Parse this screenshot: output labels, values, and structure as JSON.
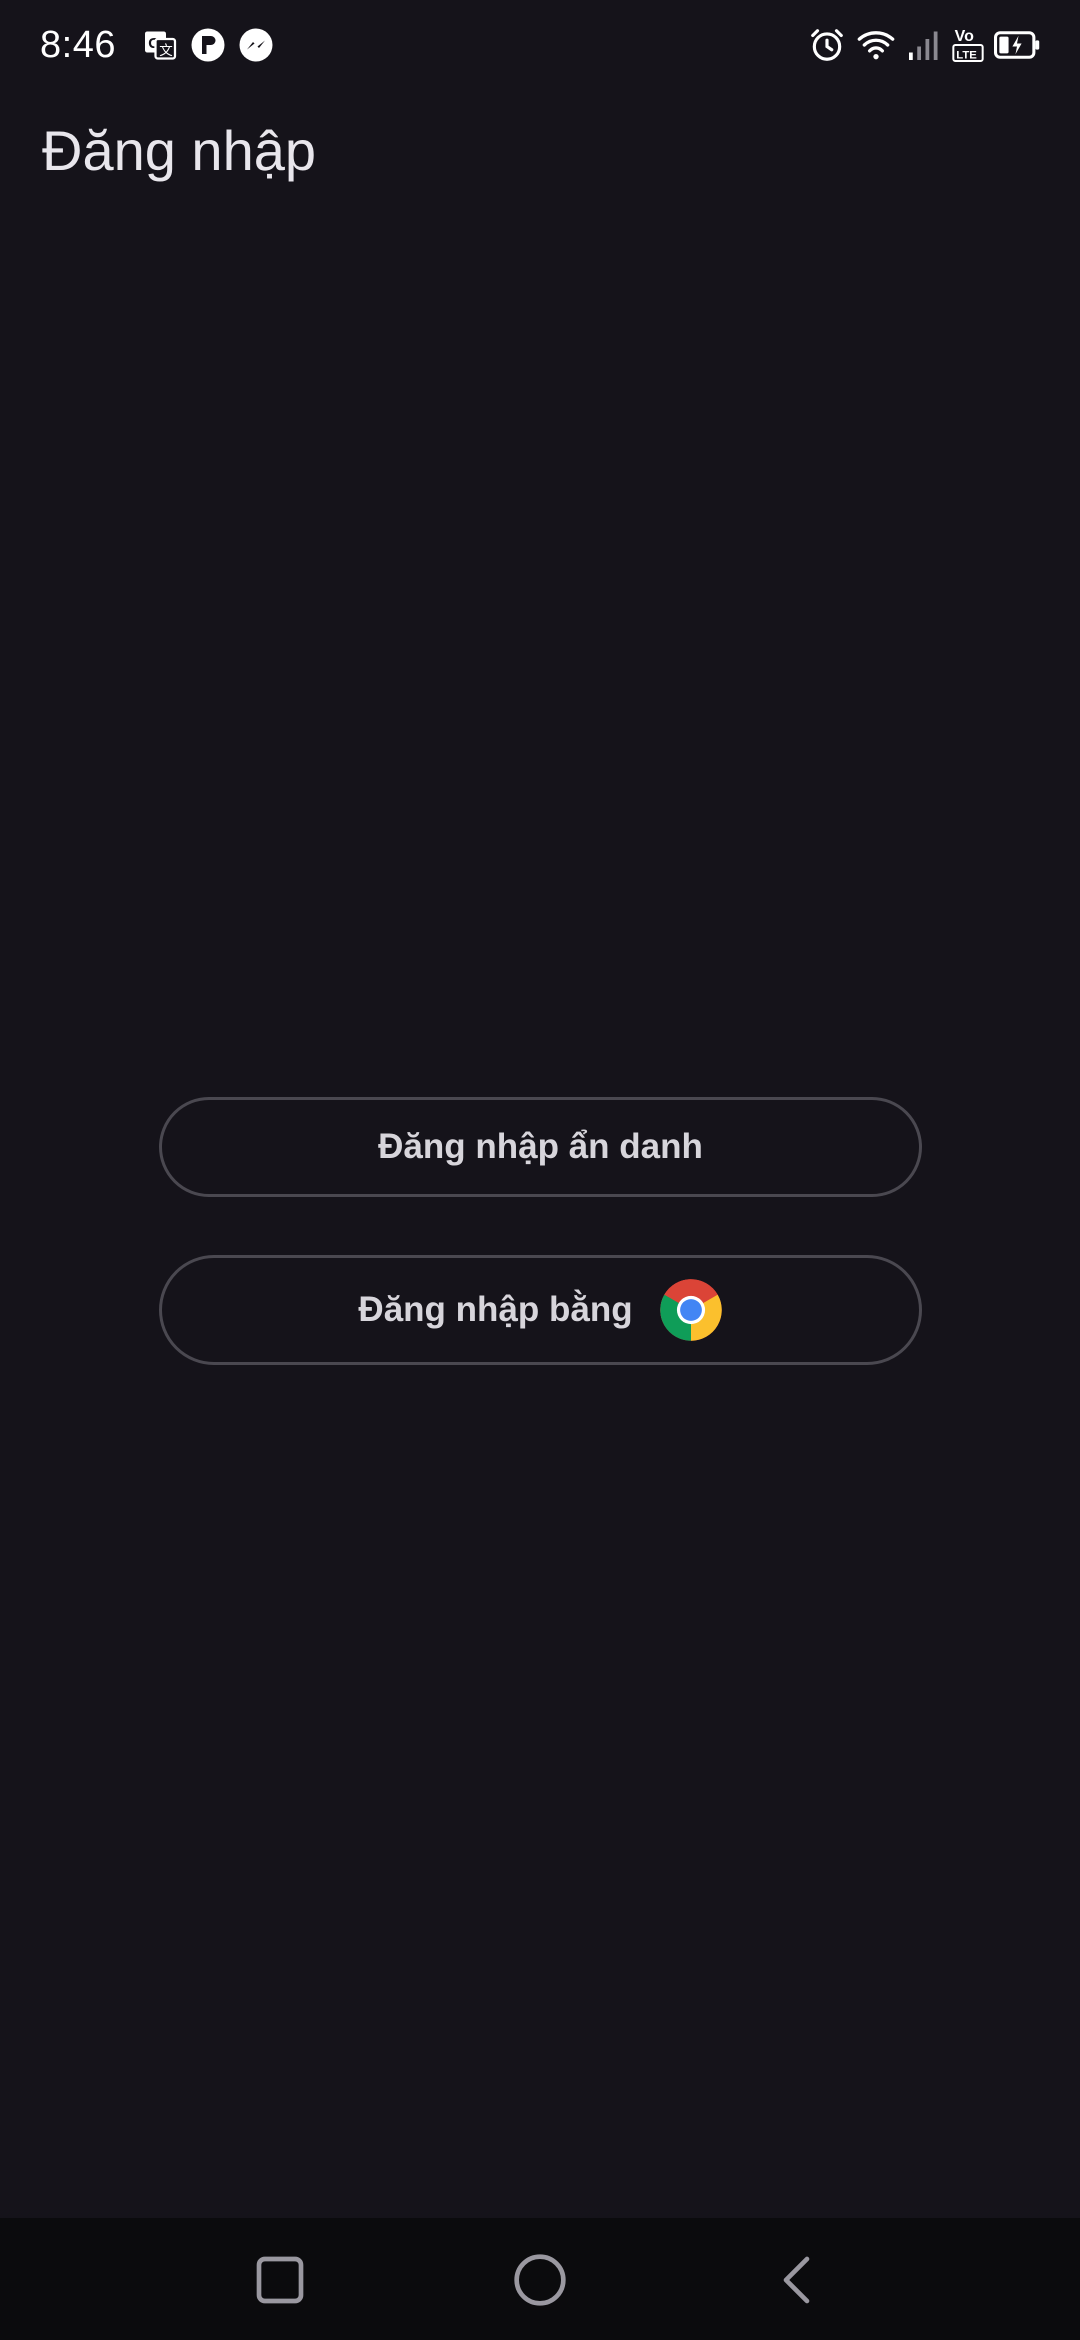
{
  "status_bar": {
    "time": "8:46",
    "notification_icons": [
      "translate-icon",
      "app-notification-icon",
      "messenger-icon"
    ],
    "system_icons": [
      "alarm-icon",
      "wifi-icon",
      "signal-icon",
      "volte-icon",
      "battery-charging-icon"
    ],
    "volte_label_top": "Vo",
    "volte_label_bottom": "LTE"
  },
  "page": {
    "title": "Đăng nhập"
  },
  "buttons": {
    "incognito_label": "Đăng nhập ẩn danh",
    "google_label": "Đăng nhập bằng",
    "google_icon": "chrome-icon"
  },
  "nav_bar": {
    "items": [
      "recent-apps",
      "home",
      "back"
    ]
  },
  "colors": {
    "background": "#15131a",
    "button_border": "#4a4850",
    "nav_background": "#0b0b0d"
  }
}
